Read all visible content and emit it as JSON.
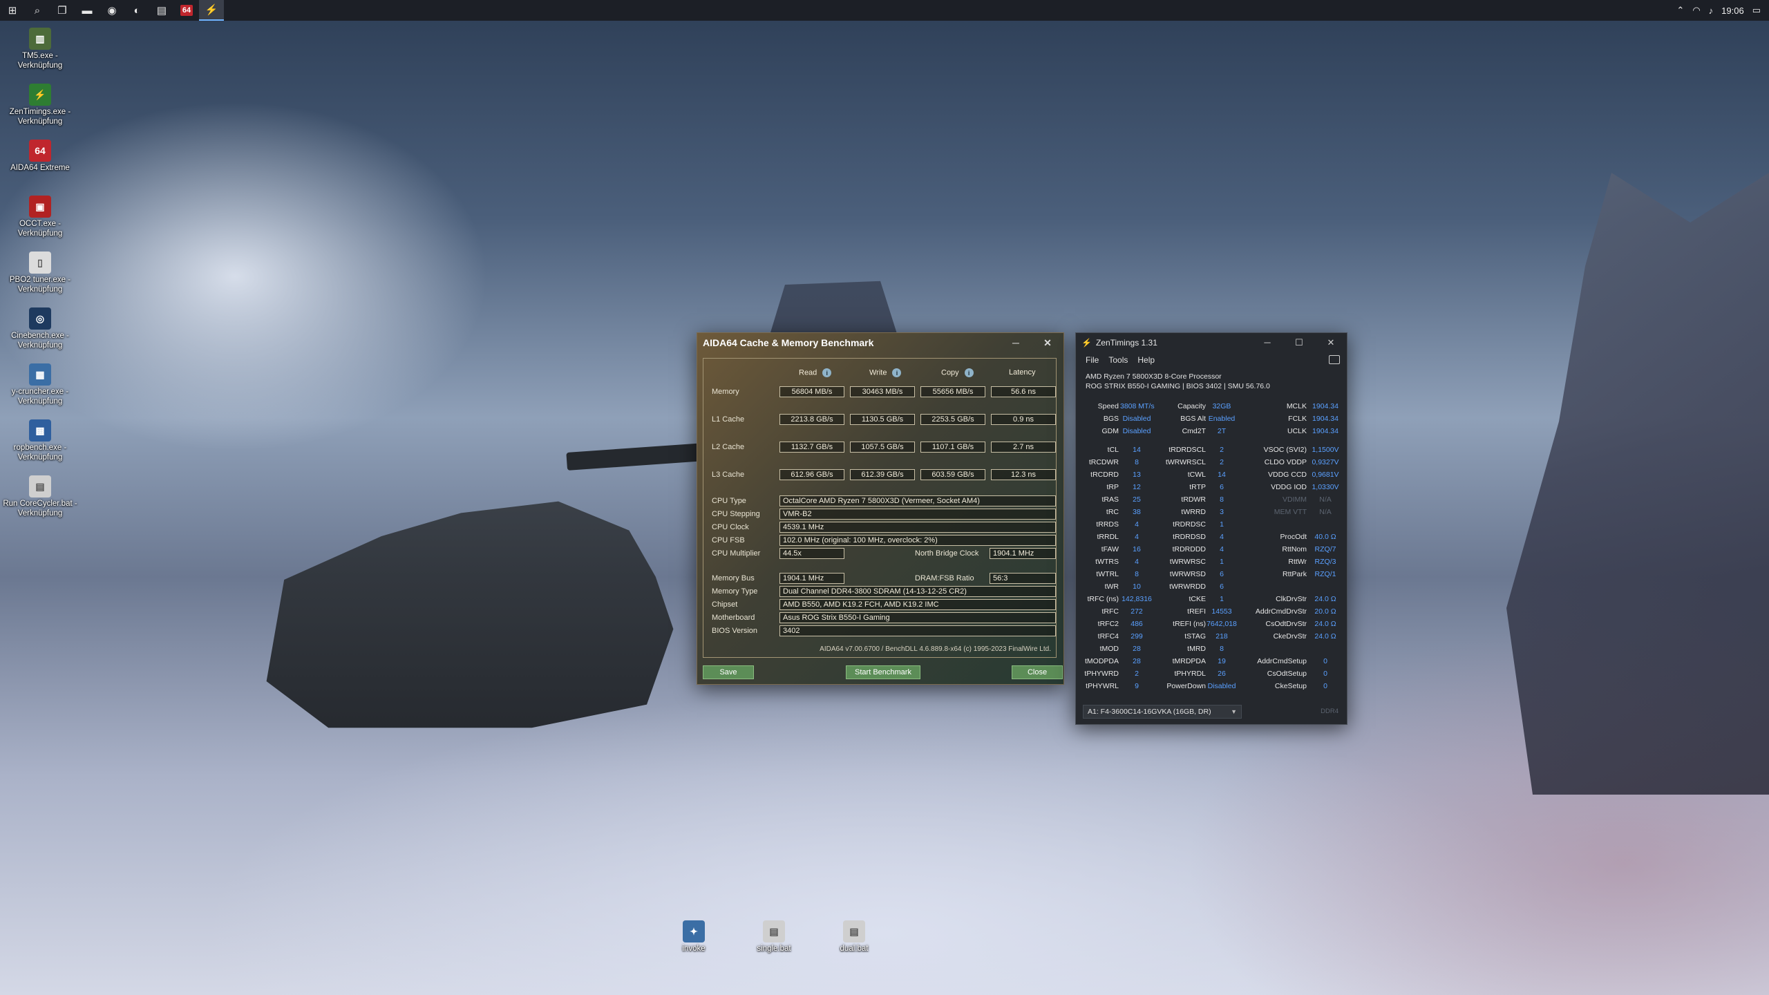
{
  "taskbar": {
    "icons": [
      {
        "name": "start-icon",
        "glyph": "⊞"
      },
      {
        "name": "search-icon",
        "glyph": "⌕"
      },
      {
        "name": "task-view-icon",
        "glyph": "❐"
      },
      {
        "name": "file-explorer-icon",
        "glyph": "▬"
      },
      {
        "name": "chrome-icon",
        "glyph": "◉"
      },
      {
        "name": "edge-icon",
        "glyph": "◐"
      },
      {
        "name": "app-icon",
        "glyph": "▤"
      },
      {
        "name": "aida64-taskbar-icon",
        "glyph": "64"
      },
      {
        "name": "zentimings-taskbar-icon",
        "glyph": "⚡"
      }
    ],
    "clock": "19:06"
  },
  "desktop_icons": [
    {
      "name": "tm5-shortcut",
      "label": "TM5.exe - Verknüpfung",
      "glyph": "▥",
      "color": "#4d6b3a"
    },
    {
      "name": "zentimings-shortcut",
      "label": "ZenTimings.exe - Verknüpfung",
      "glyph": "⚡",
      "color": "#2e7d32"
    },
    {
      "name": "aida64-shortcut",
      "label": "AIDA64 Extreme",
      "glyph": "64",
      "color": "#c0262d"
    },
    {
      "name": "occt-shortcut",
      "label": "OCCT.exe - Verknüpfung",
      "glyph": "▣",
      "color": "#b22222"
    },
    {
      "name": "prime95-shortcut",
      "label": "PBO2 tuner.exe - Verknüpfung",
      "glyph": "▯",
      "color": "#dcdcdc"
    },
    {
      "name": "cinebench-shortcut",
      "label": "Cinebench.exe - Verknüpfung",
      "glyph": "◎",
      "color": "#1e3a5f"
    },
    {
      "name": "y-cruncher-shortcut",
      "label": "y-cruncher.exe - Verknüpfung",
      "glyph": "▦",
      "color": "#3b6ea5"
    },
    {
      "name": "ropbench-shortcut",
      "label": "ropbench.exe - Verknüpfung",
      "glyph": "▩",
      "color": "#2f5f9e"
    },
    {
      "name": "corecycler-shortcut",
      "label": "Run CoreCycler.bat - Verknüpfung",
      "glyph": "▤",
      "color": "#cfcfcf"
    }
  ],
  "bottom_icons": [
    {
      "name": "invoke-shortcut",
      "label": "invoke",
      "glyph": "✦",
      "color": "#3b6ea5"
    },
    {
      "name": "single-bat-shortcut",
      "label": "single.bat",
      "glyph": "▤",
      "color": "#cfcfcf"
    },
    {
      "name": "dual-bat-shortcut",
      "label": "dual.bat",
      "glyph": "▤",
      "color": "#cfcfcf"
    }
  ],
  "aida": {
    "title": "AIDA64 Cache & Memory Benchmark",
    "columns": {
      "read": "Read",
      "write": "Write",
      "copy": "Copy",
      "latency": "Latency"
    },
    "rows": [
      {
        "label": "Memory",
        "read": "56804 MB/s",
        "write": "30463 MB/s",
        "copy": "55656 MB/s",
        "latency": "56.6 ns"
      },
      {
        "label": "L1 Cache",
        "read": "2213.8 GB/s",
        "write": "1130.5 GB/s",
        "copy": "2253.5 GB/s",
        "latency": "0.9 ns"
      },
      {
        "label": "L2 Cache",
        "read": "1132.7 GB/s",
        "write": "1057.5 GB/s",
        "copy": "1107.1 GB/s",
        "latency": "2.7 ns"
      },
      {
        "label": "L3 Cache",
        "read": "612.96 GB/s",
        "write": "612.39 GB/s",
        "copy": "603.59 GB/s",
        "latency": "12.3 ns"
      }
    ],
    "info": {
      "cpu_type": {
        "label": "CPU Type",
        "value": "OctalCore AMD Ryzen 7 5800X3D (Vermeer, Socket AM4)"
      },
      "cpu_stepping": {
        "label": "CPU Stepping",
        "value": "VMR-B2"
      },
      "cpu_clock": {
        "label": "CPU Clock",
        "value": "4539.1 MHz"
      },
      "cpu_fsb": {
        "label": "CPU FSB",
        "value": "102.0 MHz  (original: 100 MHz, overclock: 2%)"
      },
      "cpu_multiplier": {
        "label": "CPU Multiplier",
        "value": "44.5x"
      },
      "nb_clock": {
        "label": "North Bridge Clock",
        "value": "1904.1 MHz"
      },
      "memory_bus": {
        "label": "Memory Bus",
        "value": "1904.1 MHz"
      },
      "dram_fsb": {
        "label": "DRAM:FSB Ratio",
        "value": "56:3"
      },
      "memory_type": {
        "label": "Memory Type",
        "value": "Dual Channel DDR4-3800 SDRAM  (14-13-12-25 CR2)"
      },
      "chipset": {
        "label": "Chipset",
        "value": "AMD B550, AMD K19.2 FCH, AMD K19.2 IMC"
      },
      "motherboard": {
        "label": "Motherboard",
        "value": "Asus ROG Strix B550-I Gaming"
      },
      "bios": {
        "label": "BIOS Version",
        "value": "3402"
      }
    },
    "footer": "AIDA64 v7.00.6700 / BenchDLL 4.6.889.8-x64  (c) 1995-2023 FinalWire Ltd.",
    "buttons": {
      "save": "Save",
      "start": "Start Benchmark",
      "close": "Close"
    }
  },
  "zen": {
    "title": "ZenTimings 1.31",
    "menu": [
      "File",
      "Tools",
      "Help"
    ],
    "cpu": "AMD Ryzen 7 5800X3D 8-Core Processor",
    "board": "ROG STRIX B550-I GAMING | BIOS 3402 | SMU 56.76.0",
    "top_rows": [
      [
        "Speed",
        "3808 MT/s",
        "Capacity",
        "32GB",
        "MCLK",
        "1904.34"
      ],
      [
        "BGS",
        "Disabled",
        "BGS Alt",
        "Enabled",
        "FCLK",
        "1904.34"
      ],
      [
        "GDM",
        "Disabled",
        "Cmd2T",
        "2T",
        "UCLK",
        "1904.34"
      ]
    ],
    "timing_rows": [
      [
        "tCL",
        "14",
        "tRDRDSCL",
        "2",
        "VSOC (SVI2)",
        "1,1500V"
      ],
      [
        "tRCDWR",
        "8",
        "tWRWRSCL",
        "2",
        "CLDO VDDP",
        "0,9327V"
      ],
      [
        "tRCDRD",
        "13",
        "tCWL",
        "14",
        "VDDG CCD",
        "0,9681V"
      ],
      [
        "tRP",
        "12",
        "tRTP",
        "6",
        "VDDG IOD",
        "1,0330V"
      ],
      [
        "tRAS",
        "25",
        "tRDWR",
        "8",
        "VDIMM",
        "N/A"
      ],
      [
        "tRC",
        "38",
        "tWRRD",
        "3",
        "MEM VTT",
        "N/A"
      ],
      [
        "tRRDS",
        "4",
        "tRDRDSC",
        "1",
        "",
        ""
      ],
      [
        "tRRDL",
        "4",
        "tRDRDSD",
        "4",
        "ProcOdt",
        "40.0 Ω"
      ],
      [
        "tFAW",
        "16",
        "tRDRDDD",
        "4",
        "RttNom",
        "RZQ/7"
      ],
      [
        "tWTRS",
        "4",
        "tWRWRSC",
        "1",
        "RttWr",
        "RZQ/3"
      ],
      [
        "tWTRL",
        "8",
        "tWRWRSD",
        "6",
        "RttPark",
        "RZQ/1"
      ],
      [
        "tWR",
        "10",
        "tWRWRDD",
        "6",
        "",
        ""
      ],
      [
        "tRFC (ns)",
        "142,8316",
        "tCKE",
        "1",
        "ClkDrvStr",
        "24.0 Ω"
      ],
      [
        "tRFC",
        "272",
        "tREFI",
        "14553",
        "AddrCmdDrvStr",
        "20.0 Ω"
      ],
      [
        "tRFC2",
        "486",
        "tREFI (ns)",
        "7642,018",
        "CsOdtDrvStr",
        "24.0 Ω"
      ],
      [
        "tRFC4",
        "299",
        "tSTAG",
        "218",
        "CkeDrvStr",
        "24.0 Ω"
      ],
      [
        "tMOD",
        "28",
        "tMRD",
        "8",
        "",
        ""
      ],
      [
        "tMODPDA",
        "28",
        "tMRDPDA",
        "19",
        "AddrCmdSetup",
        "0"
      ],
      [
        "tPHYWRD",
        "2",
        "tPHYRDL",
        "26",
        "CsOdtSetup",
        "0"
      ],
      [
        "tPHYWRL",
        "9",
        "PowerDown",
        "Disabled",
        "CkeSetup",
        "0"
      ]
    ],
    "module": "A1: F4-3600C14-16GVKA (16GB, DR)",
    "ddr": "DDR4"
  }
}
